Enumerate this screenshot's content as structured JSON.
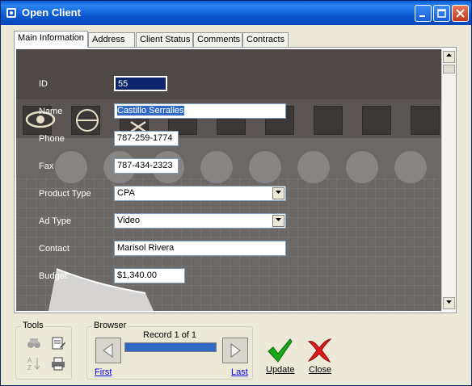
{
  "window": {
    "title": "Open Client"
  },
  "tabs": [
    "Main Information",
    "Address",
    "Client Status",
    "Comments",
    "Contracts"
  ],
  "form": {
    "id": {
      "label": "ID",
      "value": "55"
    },
    "name": {
      "label": "Name",
      "value": "Castillo Serralles"
    },
    "phone": {
      "label": "Phone",
      "value": "787-259-1774"
    },
    "fax": {
      "label": "Fax",
      "value": "787-434-2323"
    },
    "product_type": {
      "label": "Product Type",
      "value": "CPA"
    },
    "ad_type": {
      "label": "Ad Type",
      "value": "Video"
    },
    "contact": {
      "label": "Contact",
      "value": "Marisol Rivera"
    },
    "budget": {
      "label": "Budget",
      "value": "$1,340.00"
    }
  },
  "tools": {
    "label": "Tools"
  },
  "browser": {
    "label": "Browser",
    "record_text": "Record 1 of 1",
    "progress": 1.0,
    "first_label": "First",
    "last_label": "Last"
  },
  "actions": {
    "update_label": "Update",
    "close_label": "Close"
  },
  "colors": {
    "titlebar": "#0a5fd8",
    "selection": "#316ac5",
    "link": "#0000ee"
  }
}
